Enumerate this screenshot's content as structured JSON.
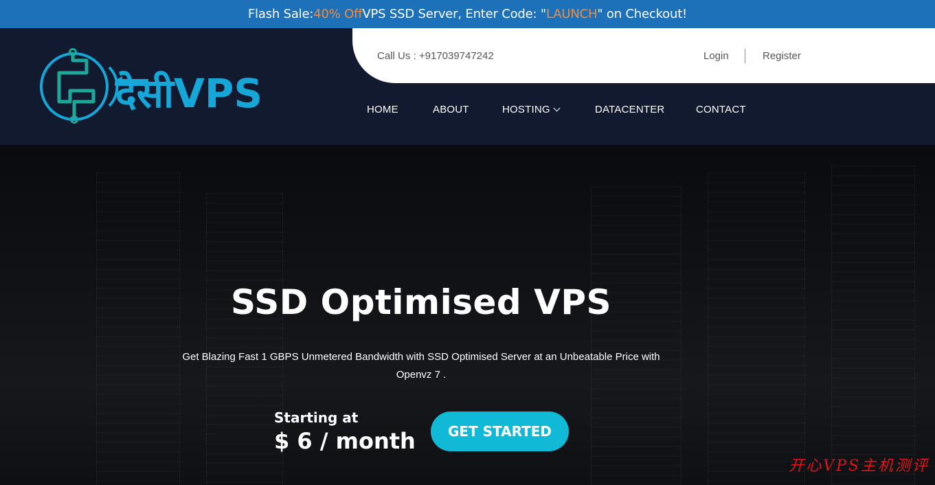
{
  "flash": {
    "prefix": "Flash Sale: ",
    "discount": "40% Off",
    "middle": " VPS SSD Server, Enter Code: \"",
    "code": "LAUNCH",
    "suffix": "\" on Checkout!"
  },
  "header": {
    "call": "Call Us : +917039747242",
    "login": "Login",
    "register": "Register",
    "logo_text": "देसीVPS"
  },
  "nav": {
    "home": "HOME",
    "about": "ABOUT",
    "hosting": "HOSTING",
    "datacenter": "DATACENTER",
    "contact": "CONTACT"
  },
  "hero": {
    "title": "SSD Optimised VPS",
    "subtitle": "Get Blazing Fast 1 GBPS Unmetered Bandwidth with SSD Optimised Server at an Unbeatable Price with Openvz 7 .",
    "starting": "Starting at",
    "price": "$ 6 / month",
    "cta": "GET STARTED"
  },
  "watermark": "开心VPS主机测评",
  "colors": {
    "flash_bg": "#1c71b8",
    "accent": "#f58a3c",
    "header_bg": "#121a30",
    "cta_bg": "#10b9d6",
    "logo_cyan": "#16a6d8",
    "logo_teal": "#1ea89a"
  }
}
